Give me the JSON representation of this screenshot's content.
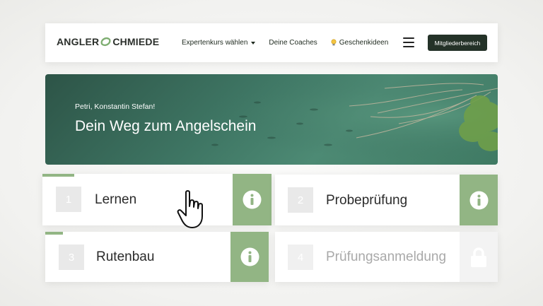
{
  "header": {
    "logo_text_left": "ANGLER",
    "logo_text_right": "CHMIEDE",
    "menu": [
      {
        "label": "Expertenkurs wählen",
        "has_dropdown": true
      },
      {
        "label": "Deine Coaches",
        "has_dropdown": false
      },
      {
        "label": "Geschenkideen",
        "icon": "lightbulb-icon"
      }
    ],
    "hamburger_icon": "hamburger-menu-icon",
    "member_button": "Mitgliederbereich"
  },
  "hero": {
    "greeting": "Petri, Konstantin Stefan!",
    "title": "Dein Weg zum Angelschein"
  },
  "steps": [
    {
      "number": "1",
      "label": "Lernen",
      "action_icon": "info-icon",
      "progress": 0.14,
      "locked": false
    },
    {
      "number": "2",
      "label": "Probeprüfung",
      "action_icon": "info-icon",
      "progress": 0,
      "locked": false
    },
    {
      "number": "3",
      "label": "Rutenbau",
      "action_icon": "info-icon",
      "progress": 0.08,
      "locked": false
    },
    {
      "number": "4",
      "label": "Prüfungsanmeldung",
      "action_icon": "lock-icon",
      "progress": 0,
      "locked": true
    }
  ],
  "colors": {
    "accent_green": "#92b584",
    "dark_button": "#243228",
    "hero_water": "#3e7563"
  },
  "cursor_icon": "hand-pointer-icon"
}
